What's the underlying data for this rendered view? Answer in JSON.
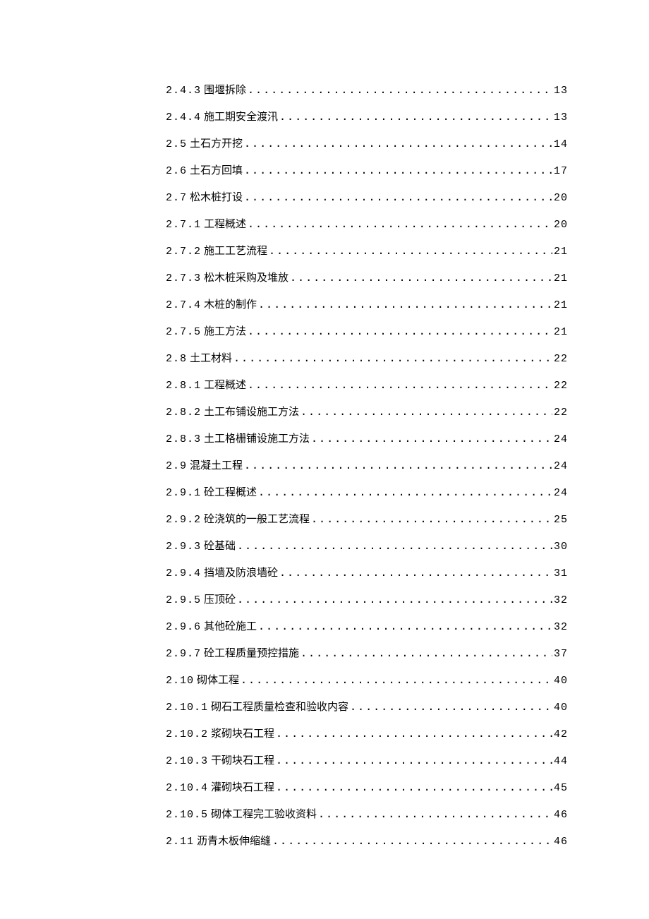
{
  "toc": [
    {
      "number": "2.4.3",
      "title": "围堰拆除",
      "page": "13"
    },
    {
      "number": "2.4.4",
      "title": "施工期安全渡汛",
      "page": "13"
    },
    {
      "number": "2.5",
      "title": "土石方开挖",
      "page": "14"
    },
    {
      "number": "2.6",
      "title": "土石方回填",
      "page": "17"
    },
    {
      "number": "2.7",
      "title": "松木桩打设",
      "page": "20"
    },
    {
      "number": "2.7.1",
      "title": "工程概述",
      "page": "20"
    },
    {
      "number": "2.7.2",
      "title": "施工工艺流程",
      "page": "21"
    },
    {
      "number": "2.7.3",
      "title": "松木桩采购及堆放",
      "page": "21"
    },
    {
      "number": "2.7.4",
      "title": "木桩的制作",
      "page": "21"
    },
    {
      "number": "2.7.5",
      "title": "施工方法",
      "page": "21"
    },
    {
      "number": "2.8",
      "title": "土工材料",
      "page": "22"
    },
    {
      "number": "2.8.1",
      "title": "工程概述",
      "page": "22"
    },
    {
      "number": "2.8.2",
      "title": "土工布铺设施工方法",
      "page": "22"
    },
    {
      "number": "2.8.3",
      "title": "土工格栅铺设施工方法",
      "page": "24"
    },
    {
      "number": "2.9",
      "title": "混凝土工程",
      "page": "24"
    },
    {
      "number": "2.9.1",
      "title": "砼工程概述",
      "page": "24"
    },
    {
      "number": "2.9.2",
      "title": "砼浇筑的一般工艺流程",
      "page": "25"
    },
    {
      "number": "2.9.3",
      "title": "砼基础",
      "page": "30"
    },
    {
      "number": "2.9.4",
      "title": "挡墙及防浪墙砼",
      "page": "31"
    },
    {
      "number": "2.9.5",
      "title": "压顶砼",
      "page": "32"
    },
    {
      "number": "2.9.6",
      "title": "其他砼施工",
      "page": "32"
    },
    {
      "number": "2.9.7",
      "title": "砼工程质量预控措施",
      "page": "37"
    },
    {
      "number": "2.10",
      "title": "砌体工程",
      "page": "40"
    },
    {
      "number": "2.10.1",
      "title": "砌石工程质量检查和验收内容",
      "page": "40"
    },
    {
      "number": "2.10.2",
      "title": "浆砌块石工程",
      "page": "42"
    },
    {
      "number": "2.10.3",
      "title": "干砌块石工程",
      "page": "44"
    },
    {
      "number": "2.10.4",
      "title": "灌砌块石工程",
      "page": "45"
    },
    {
      "number": "2.10.5",
      "title": "砌体工程完工验收资料",
      "page": "46"
    },
    {
      "number": "2.11",
      "title": "沥青木板伸缩缝",
      "page": "46"
    }
  ]
}
